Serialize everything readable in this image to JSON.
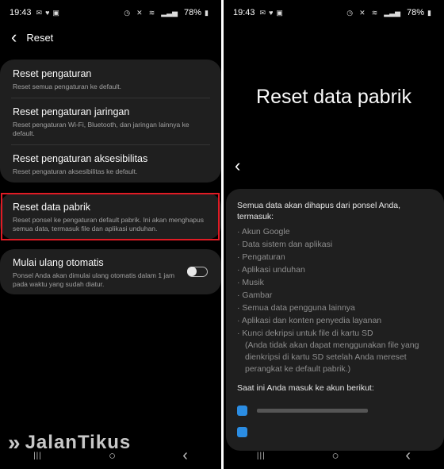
{
  "left": {
    "status": {
      "time": "19:43",
      "battery": "78%"
    },
    "header": {
      "back_icon": "‹",
      "title": "Reset"
    },
    "items": [
      {
        "title": "Reset pengaturan",
        "desc": "Reset semua pengaturan ke default."
      },
      {
        "title": "Reset pengaturan jaringan",
        "desc": "Reset pengaturan Wi-Fi, Bluetooth, dan jaringan lainnya ke default."
      },
      {
        "title": "Reset pengaturan aksesibilitas",
        "desc": "Reset pengaturan aksesibilitas ke default."
      }
    ],
    "factory": {
      "title": "Reset data pabrik",
      "desc": "Reset ponsel ke pengaturan default pabrik. Ini akan menghapus semua data, termasuk file dan aplikasi unduhan."
    },
    "auto": {
      "title": "Mulai ulang otomatis",
      "desc": "Ponsel Anda akan dimulai ulang otomatis dalam 1 jam pada waktu yang sudah diatur.",
      "toggle_on": false
    },
    "watermark": "JalanTikus",
    "highlight_color": "#e01b24"
  },
  "right": {
    "status": {
      "time": "19:43",
      "battery": "78%"
    },
    "title": "Reset data pabrik",
    "back_icon": "‹",
    "intro": "Semua data akan dihapus dari ponsel Anda, termasuk:",
    "bullets": [
      "Akun Google",
      "Data sistem dan aplikasi",
      "Pengaturan",
      "Aplikasi unduhan",
      "Musik",
      "Gambar",
      "Semua data pengguna lainnya",
      "Aplikasi dan konten penyedia layanan",
      "Kunci dekripsi untuk file di kartu SD"
    ],
    "note": "(Anda tidak akan dapat menggunakan file yang dienkripsi di kartu SD setelah Anda mereset perangkat ke default pabrik.)",
    "accounts_heading": "Saat ini Anda masuk ke akun berikut:"
  },
  "nav": {
    "recent": "|||",
    "home": "○",
    "back": "‹"
  }
}
